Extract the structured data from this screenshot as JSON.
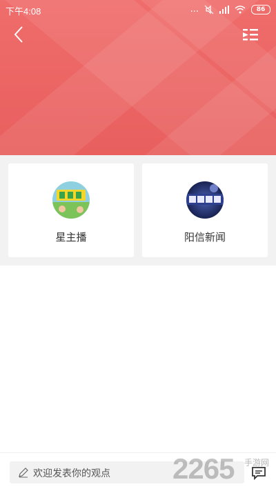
{
  "status_bar": {
    "time": "下午4:08",
    "dots": "...",
    "battery": "86"
  },
  "header": {
    "back_icon": "chevron-left-icon",
    "menu_icon": "playlist-icon"
  },
  "channels": [
    {
      "label": "星主播",
      "icon": "channel-avatar-image"
    },
    {
      "label": "阳信新闻",
      "icon": "channel-avatar-image"
    }
  ],
  "bottom_bar": {
    "placeholder": "欢迎发表你的观点",
    "comment_icon": "comment-icon"
  },
  "watermark": {
    "text": "2265",
    "sub": "手游网"
  },
  "colors": {
    "header": "#ea6563",
    "card_bg": "#ffffff",
    "page_bg": "#f2f2f2"
  }
}
